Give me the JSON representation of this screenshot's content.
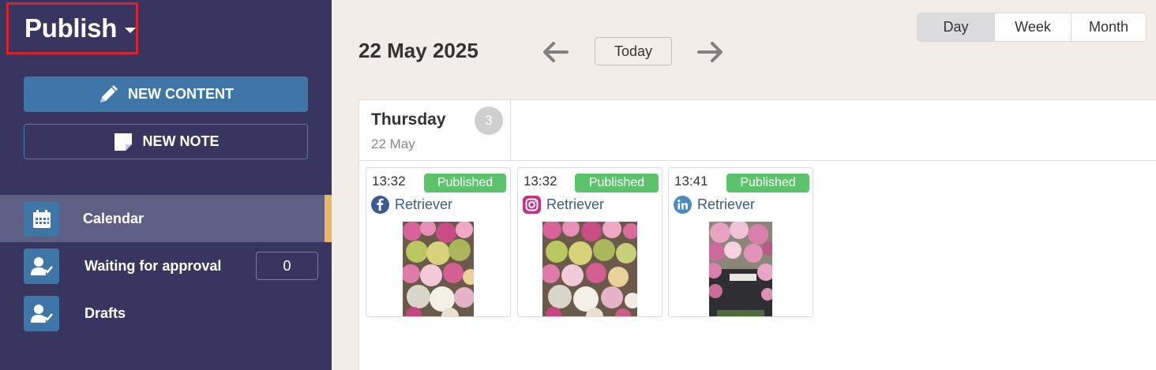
{
  "sidebar": {
    "publish_title": "Publish",
    "new_content_label": "NEW CONTENT",
    "new_note_label": "NEW NOTE",
    "nav": {
      "calendar": "Calendar",
      "waiting": "Waiting for approval",
      "waiting_count": "0",
      "drafts": "Drafts"
    }
  },
  "toolbar": {
    "date": "22 May 2025",
    "today": "Today",
    "views": [
      "Day",
      "Week",
      "Month"
    ],
    "active_view": "Day"
  },
  "day": {
    "name": "Thursday",
    "date": "22 May",
    "count": "3"
  },
  "posts": [
    {
      "time": "13:32",
      "status": "Published",
      "network": "facebook-icon",
      "account": "Retriever"
    },
    {
      "time": "13:32",
      "status": "Published",
      "network": "instagram-icon",
      "account": "Retriever"
    },
    {
      "time": "13:41",
      "status": "Published",
      "network": "linkedin-icon",
      "account": "Retriever"
    }
  ],
  "colors": {
    "sidebar_bg": "#383660",
    "accent_blue": "#3f76a8",
    "published_green": "#5cc26b",
    "active_marker": "#e9b766",
    "highlight_red": "#d9232d"
  }
}
